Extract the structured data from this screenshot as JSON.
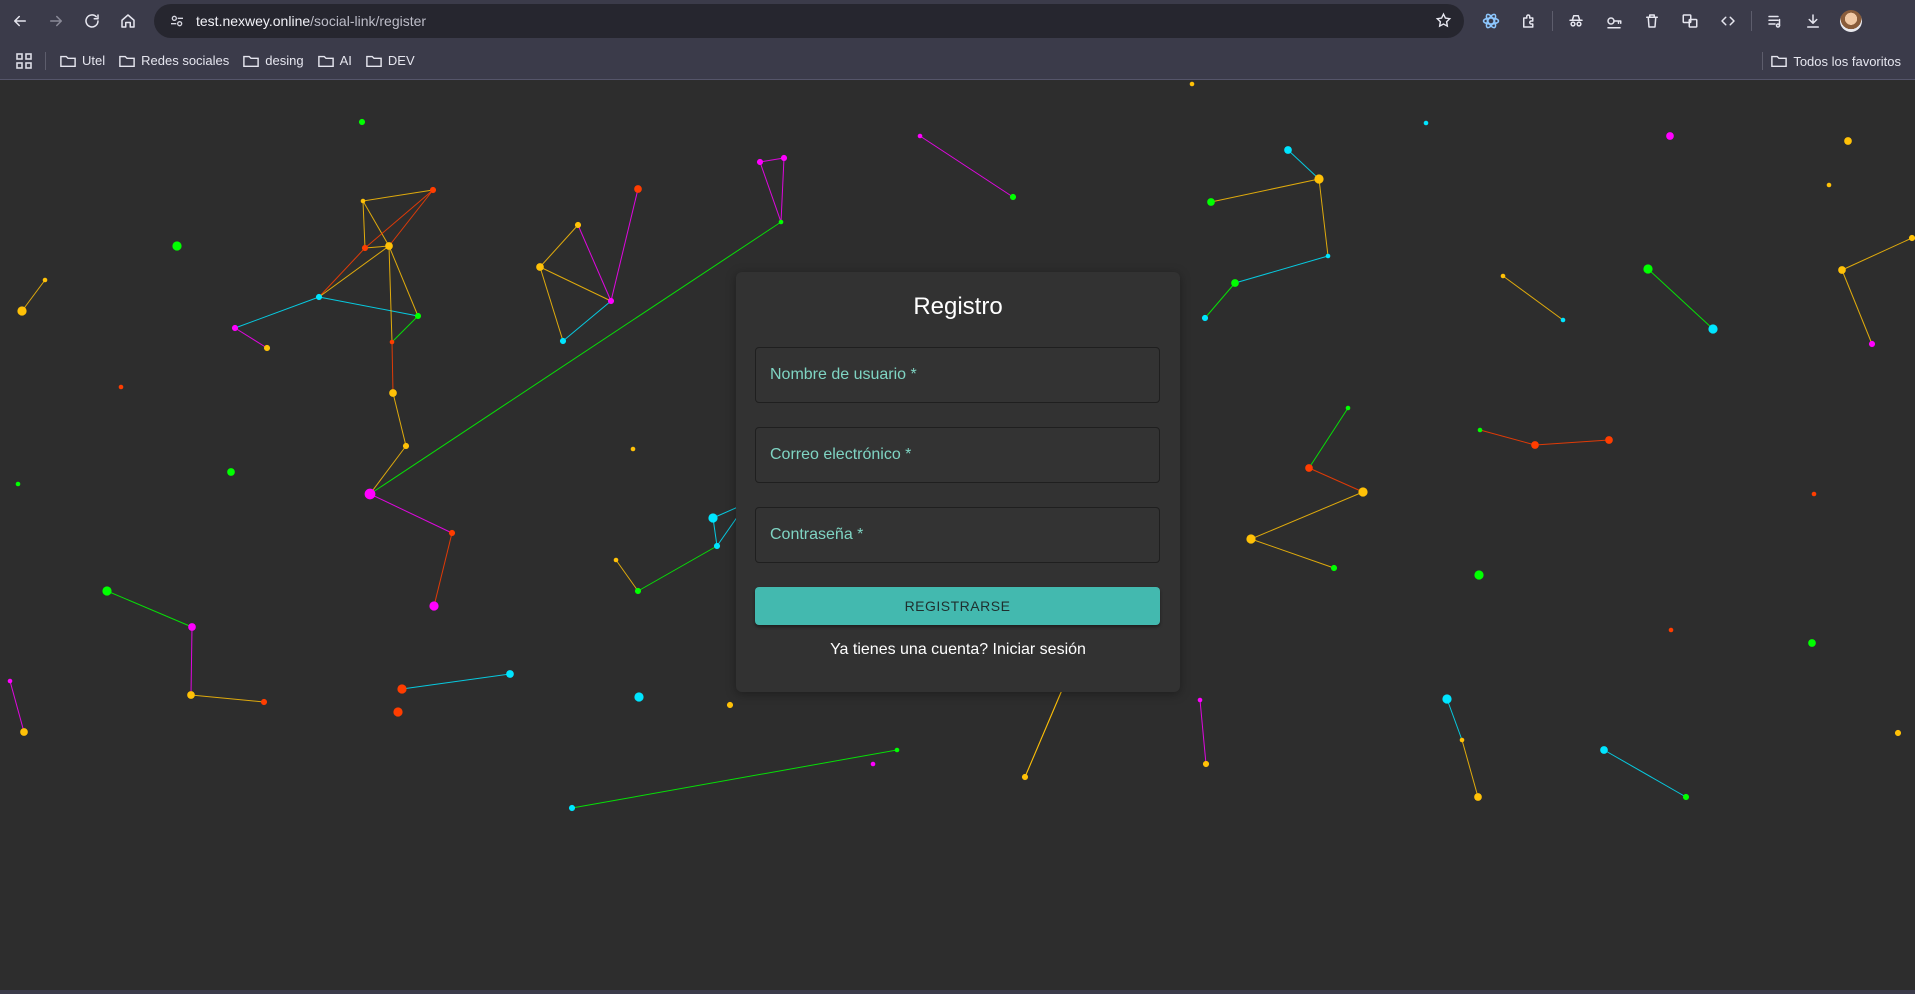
{
  "browser": {
    "url_domain": "test.nexwey.online",
    "url_path": "/social-link/register",
    "bookmarks": [
      "Utel",
      "Redes sociales",
      "desing",
      "AI",
      "DEV"
    ],
    "all_bookmarks_label": "Todos los favoritos"
  },
  "form": {
    "title": "Registro",
    "username_placeholder": "Nombre de usuario *",
    "email_placeholder": "Correo electrónico *",
    "password_placeholder": "Contraseña *",
    "submit_label": "REGISTRARSE",
    "login_link": "Ya tienes una cuenta? Iniciar sesión"
  },
  "colors": {
    "accent": "#43b9af",
    "particle_colors": [
      "#ff3d00",
      "#ffc107",
      "#00ff00",
      "#00e5ff",
      "#ff00ff"
    ]
  }
}
